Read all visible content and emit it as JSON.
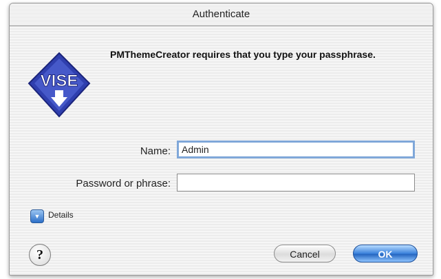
{
  "window": {
    "title": "Authenticate"
  },
  "icon": {
    "logo_text": "VISE",
    "name": "vise-logo-icon"
  },
  "message": "PMThemeCreator requires that you type your passphrase.",
  "form": {
    "name_label": "Name:",
    "name_value": "Admin",
    "password_label": "Password or phrase:",
    "password_value": ""
  },
  "details": {
    "label": "Details",
    "icon": "disclosure-triangle-icon"
  },
  "help": {
    "glyph": "?"
  },
  "buttons": {
    "cancel": "Cancel",
    "ok": "OK"
  },
  "colors": {
    "accent": "#3b82dc",
    "focus_ring": "#7fa7d9"
  }
}
